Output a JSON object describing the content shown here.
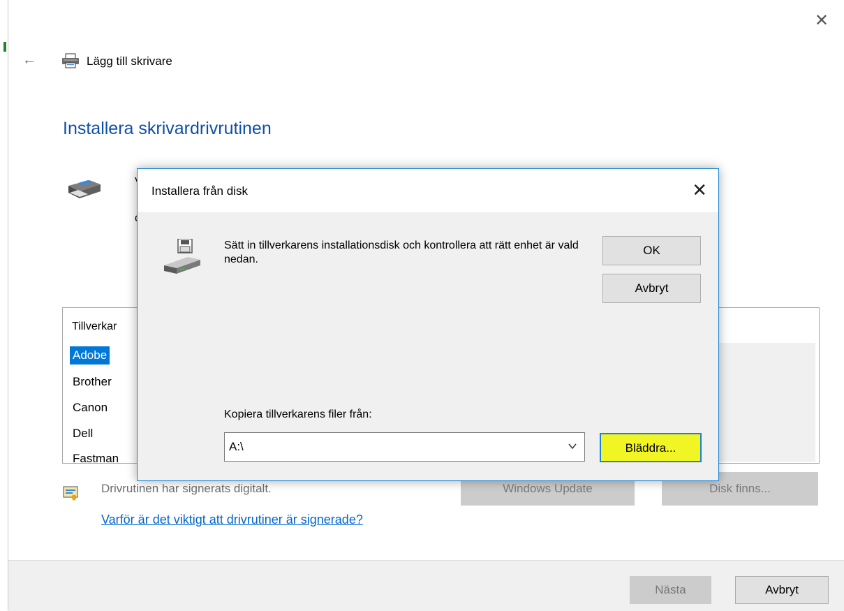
{
  "window": {
    "wizard_title": "Lägg till skrivare",
    "heading": "Installera skrivardrivrutinen",
    "partial_text_1": "V",
    "partial_text_2": "d"
  },
  "list": {
    "column_header": "Tillverkar",
    "items": [
      "Adobe",
      "Brother",
      "Canon",
      "Dell",
      "Fastman"
    ],
    "selected_index": 0
  },
  "signature": {
    "status_text": "Drivrutinen har signerats digitalt.",
    "link_text": "Varför är det viktigt att drivrutiner är signerade?"
  },
  "buttons": {
    "windows_update": "Windows Update",
    "have_disk": "Disk finns...",
    "next": "Nästa",
    "cancel": "Avbryt"
  },
  "dialog": {
    "title": "Installera från disk",
    "message": "Sätt in tillverkarens installationsdisk och kontrollera att rätt enhet är vald nedan.",
    "ok": "OK",
    "cancel": "Avbryt",
    "copy_label": "Kopiera tillverkarens filer från:",
    "path_value": "A:\\",
    "browse": "Bläddra..."
  },
  "colors": {
    "heading": "#0f4fa8",
    "link": "#0066cc",
    "selection": "#0078d7",
    "browse_highlight": "#f1f523",
    "dialog_border": "#1883d7"
  },
  "icons": [
    "back-arrow-icon",
    "printer-icon",
    "close-icon",
    "floppy-drive-icon",
    "certificate-icon",
    "chevron-down-icon"
  ]
}
